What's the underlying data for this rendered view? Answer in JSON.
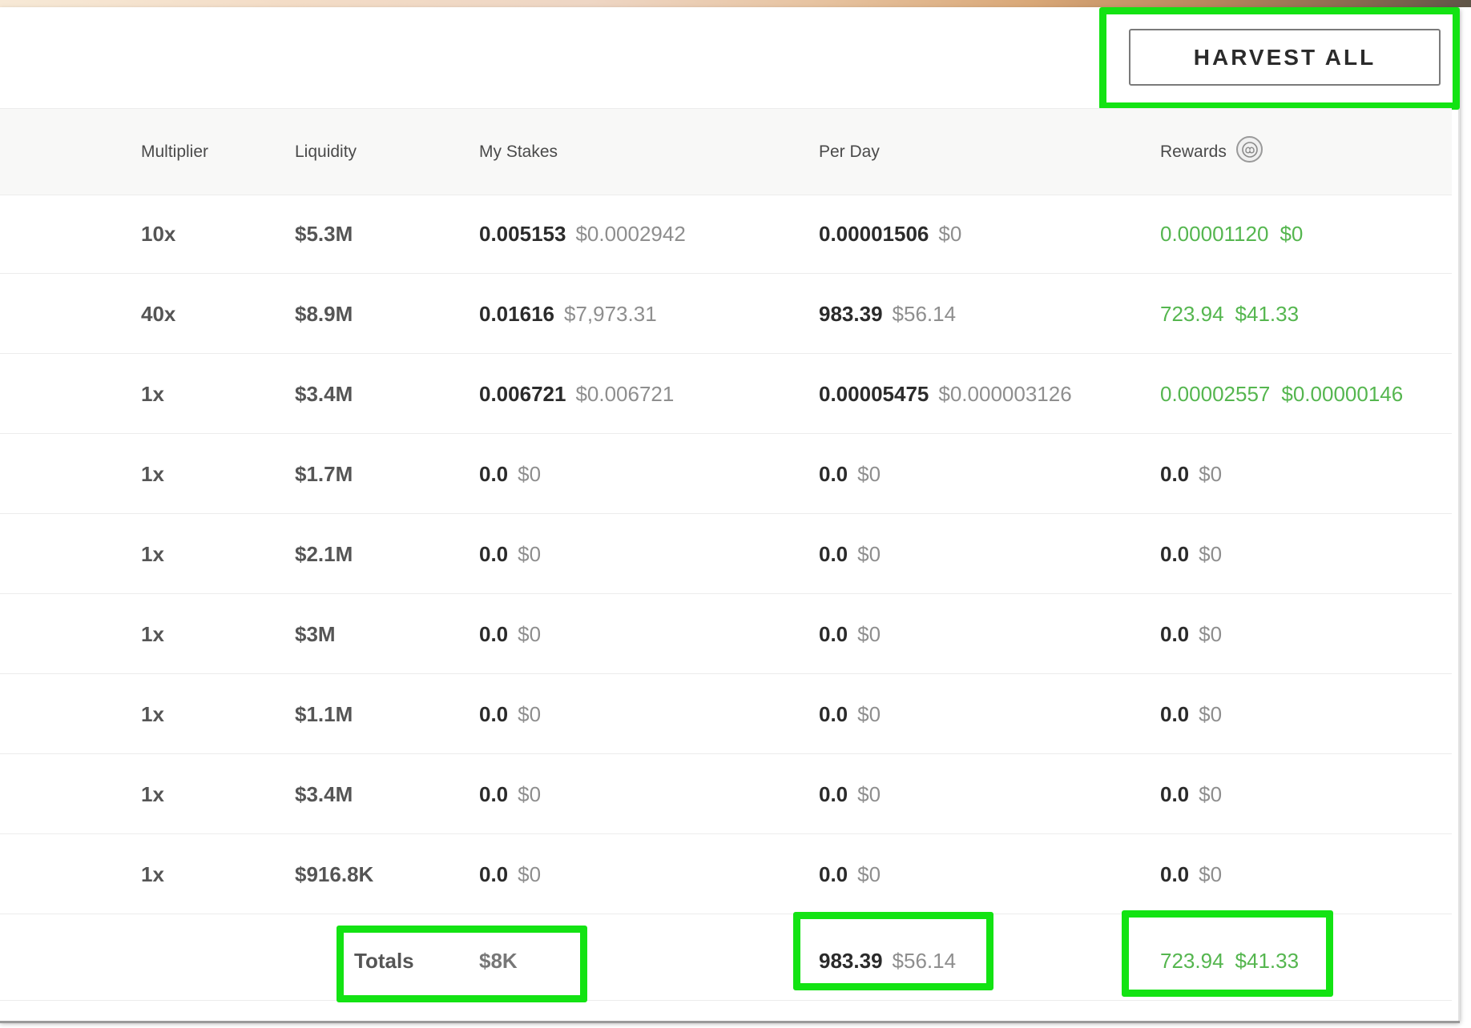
{
  "toolbar": {
    "harvest_all_label": "HARVEST ALL"
  },
  "colors": {
    "highlight": "#13e313",
    "reward_green": "#55b64f",
    "header_bg": "#f8f8f7"
  },
  "icons": {
    "rewards": "rewards-token-icon"
  },
  "table": {
    "headers": {
      "multiplier": "Multiplier",
      "liquidity": "Liquidity",
      "my_stakes": "My Stakes",
      "per_day": "Per Day",
      "rewards": "Rewards"
    },
    "rows": [
      {
        "multiplier": "10x",
        "liquidity": "$5.3M",
        "stake": "0.005153",
        "stake_usd": "$0.0002942",
        "perday": "0.00001506",
        "perday_usd": "$0",
        "reward": "0.00001120",
        "reward_usd": "$0"
      },
      {
        "multiplier": "40x",
        "liquidity": "$8.9M",
        "stake": "0.01616",
        "stake_usd": "$7,973.31",
        "perday": "983.39",
        "perday_usd": "$56.14",
        "reward": "723.94",
        "reward_usd": "$41.33"
      },
      {
        "multiplier": "1x",
        "liquidity": "$3.4M",
        "stake": "0.006721",
        "stake_usd": "$0.006721",
        "perday": "0.00005475",
        "perday_usd": "$0.000003126",
        "reward": "0.00002557",
        "reward_usd": "$0.00000146"
      },
      {
        "multiplier": "1x",
        "liquidity": "$1.7M",
        "stake": "0.0",
        "stake_usd": "$0",
        "perday": "0.0",
        "perday_usd": "$0",
        "reward": "0.0",
        "reward_usd": "$0"
      },
      {
        "multiplier": "1x",
        "liquidity": "$2.1M",
        "stake": "0.0",
        "stake_usd": "$0",
        "perday": "0.0",
        "perday_usd": "$0",
        "reward": "0.0",
        "reward_usd": "$0"
      },
      {
        "multiplier": "1x",
        "liquidity": "$3M",
        "stake": "0.0",
        "stake_usd": "$0",
        "perday": "0.0",
        "perday_usd": "$0",
        "reward": "0.0",
        "reward_usd": "$0"
      },
      {
        "multiplier": "1x",
        "liquidity": "$1.1M",
        "stake": "0.0",
        "stake_usd": "$0",
        "perday": "0.0",
        "perday_usd": "$0",
        "reward": "0.0",
        "reward_usd": "$0"
      },
      {
        "multiplier": "1x",
        "liquidity": "$3.4M",
        "stake": "0.0",
        "stake_usd": "$0",
        "perday": "0.0",
        "perday_usd": "$0",
        "reward": "0.0",
        "reward_usd": "$0"
      },
      {
        "multiplier": "1x",
        "liquidity": "$916.8K",
        "stake": "0.0",
        "stake_usd": "$0",
        "perday": "0.0",
        "perday_usd": "$0",
        "reward": "0.0",
        "reward_usd": "$0"
      }
    ],
    "totals": {
      "label": "Totals",
      "stake_usd": "$8K",
      "perday": "983.39",
      "perday_usd": "$56.14",
      "reward": "723.94",
      "reward_usd": "$41.33"
    }
  }
}
